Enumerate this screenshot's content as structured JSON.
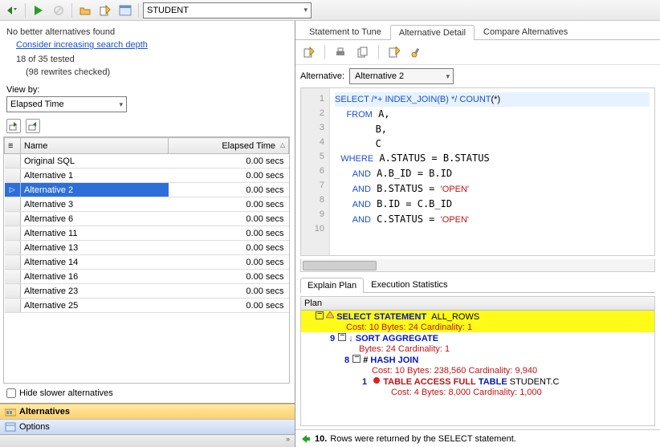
{
  "toolbar": {
    "source": "STUDENT"
  },
  "summary": {
    "no_better": "No better alternatives found",
    "suggestion": "Consider increasing search depth",
    "tested": "18 of 35 tested",
    "rewrites": "(98 rewrites checked)"
  },
  "viewby": {
    "label": "View by:",
    "value": "Elapsed Time"
  },
  "grid": {
    "headers": {
      "name": "Name",
      "elapsed": "Elapsed Time"
    },
    "rows": [
      {
        "name": "Original SQL",
        "elapsed": "0.00 secs"
      },
      {
        "name": "Alternative 1",
        "elapsed": "0.00 secs"
      },
      {
        "name": "Alternative 2",
        "elapsed": "0.00 secs",
        "selected": true
      },
      {
        "name": "Alternative 3",
        "elapsed": "0.00 secs"
      },
      {
        "name": "Alternative 6",
        "elapsed": "0.00 secs"
      },
      {
        "name": "Alternative 11",
        "elapsed": "0.00 secs"
      },
      {
        "name": "Alternative 13",
        "elapsed": "0.00 secs"
      },
      {
        "name": "Alternative 14",
        "elapsed": "0.00 secs"
      },
      {
        "name": "Alternative 16",
        "elapsed": "0.00 secs"
      },
      {
        "name": "Alternative 23",
        "elapsed": "0.00 secs"
      },
      {
        "name": "Alternative 25",
        "elapsed": "0.00 secs"
      }
    ]
  },
  "hide_label": "Hide slower alternatives",
  "nav": {
    "alternatives": "Alternatives",
    "options": "Options"
  },
  "tabs": {
    "stmt": "Statement to Tune",
    "alt": "Alternative Detail",
    "cmp": "Compare Alternatives"
  },
  "alt_label": "Alternative:",
  "alt_value": "Alternative 2",
  "code": {
    "l1": "SELECT /*+ INDEX_JOIN(B) */ COUNT(*)",
    "l2": "  FROM A,",
    "l3": "       B,",
    "l4": "       C",
    "l5": " WHERE A.STATUS = B.STATUS",
    "l6": "   AND A.B_ID = B.ID",
    "l7": "   AND B.STATUS = 'OPEN'",
    "l8": "   AND B.ID = C.B_ID",
    "l9": "   AND C.STATUS = 'OPEN'"
  },
  "subtabs": {
    "plan": "Explain Plan",
    "stats": "Execution Statistics"
  },
  "plan": {
    "header": "Plan",
    "n0": {
      "op": "SELECT STATEMENT",
      "opt": "ALL_ROWS",
      "cost": "Cost: 10 Bytes: 24 Cardinality: 1"
    },
    "n1": {
      "idx": "9",
      "op": "SORT AGGREGATE",
      "cost": "Bytes: 24 Cardinality: 1"
    },
    "n2": {
      "idx": "8",
      "op": "HASH JOIN",
      "cost": "Cost: 10 Bytes: 238,560  Cardinality: 9,940"
    },
    "n3": {
      "idx": "1",
      "op": "TABLE ACCESS FULL",
      "tbl": "TABLE",
      "name": "STUDENT.C",
      "cost": "Cost: 4 Bytes: 8,000  Cardinality: 1,000"
    }
  },
  "status": {
    "num": "10.",
    "msg": "Rows were returned by the SELECT statement."
  }
}
